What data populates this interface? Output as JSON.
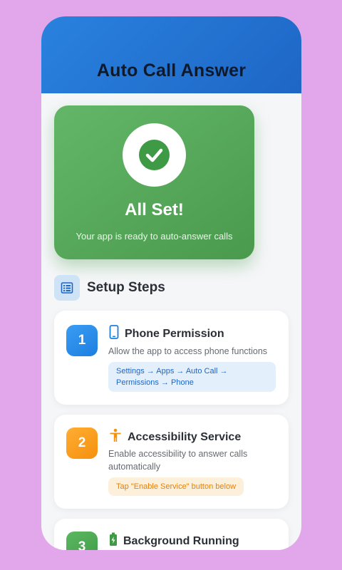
{
  "header": {
    "title": "Auto Call Answer"
  },
  "hero": {
    "title": "All Set!",
    "subtitle": "Your app is ready to auto-answer calls",
    "icon": "check-circle-icon",
    "color": "#4caf50"
  },
  "section": {
    "title": "Setup Steps",
    "icon": "list-icon"
  },
  "steps": [
    {
      "number": "1",
      "title": "Phone Permission",
      "icon": "phone-icon",
      "description": "Allow the app to access phone functions",
      "hint_line1": "Settings → Apps → Auto Call →",
      "hint_line2": "Permissions → Phone",
      "color": "#2196f3"
    },
    {
      "number": "2",
      "title": "Accessibility Service",
      "icon": "accessibility-icon",
      "description_line1": "Enable accessibility to answer calls",
      "description_line2": "automatically",
      "hint": "Tap \"Enable Service\" button below",
      "color": "#ff9800"
    },
    {
      "number": "3",
      "title": "Background Running",
      "icon": "battery-icon",
      "color": "#4caf50"
    }
  ]
}
